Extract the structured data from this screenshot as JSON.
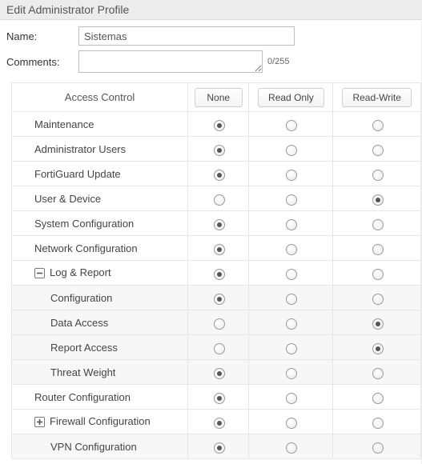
{
  "title": "Edit Administrator Profile",
  "form": {
    "name_label": "Name:",
    "name_value": "Sistemas",
    "comments_label": "Comments:",
    "comments_value": "",
    "comments_counter": "0/255"
  },
  "headers": {
    "access_control": "Access Control",
    "none": "None",
    "read_only": "Read Only",
    "read_write": "Read-Write"
  },
  "rows": [
    {
      "id": "maintenance",
      "label": "Maintenance",
      "level": 0,
      "expand": null,
      "selected": "none"
    },
    {
      "id": "admin-users",
      "label": "Administrator Users",
      "level": 0,
      "expand": null,
      "selected": "none"
    },
    {
      "id": "fortiguard-update",
      "label": "FortiGuard Update",
      "level": 0,
      "expand": null,
      "selected": "none"
    },
    {
      "id": "user-device",
      "label": "User & Device",
      "level": 0,
      "expand": null,
      "selected": "read_write"
    },
    {
      "id": "system-config",
      "label": "System Configuration",
      "level": 0,
      "expand": null,
      "selected": "none"
    },
    {
      "id": "network-config",
      "label": "Network Configuration",
      "level": 0,
      "expand": null,
      "selected": "none"
    },
    {
      "id": "log-report",
      "label": "Log & Report",
      "level": 0,
      "expand": "minus",
      "selected": "none"
    },
    {
      "id": "lr-configuration",
      "label": "Configuration",
      "level": 1,
      "expand": null,
      "selected": "none"
    },
    {
      "id": "lr-data-access",
      "label": "Data Access",
      "level": 1,
      "expand": null,
      "selected": "read_write"
    },
    {
      "id": "lr-report-access",
      "label": "Report Access",
      "level": 1,
      "expand": null,
      "selected": "read_write"
    },
    {
      "id": "lr-threat-weight",
      "label": "Threat Weight",
      "level": 1,
      "expand": null,
      "selected": "none"
    },
    {
      "id": "router-config",
      "label": "Router Configuration",
      "level": 0,
      "expand": null,
      "selected": "none"
    },
    {
      "id": "firewall-config",
      "label": "Firewall Configuration",
      "level": 0,
      "expand": "plus",
      "selected": "none"
    },
    {
      "id": "vpn-config",
      "label": "VPN Configuration",
      "level": 1,
      "expand": null,
      "selected": "none"
    }
  ]
}
